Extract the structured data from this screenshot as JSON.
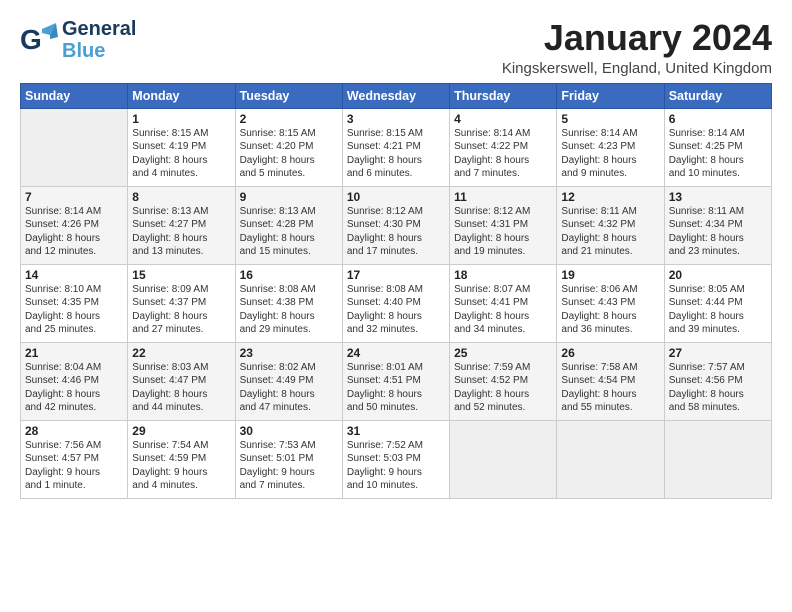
{
  "logo": {
    "line1": "General",
    "line2": "Blue"
  },
  "title": "January 2024",
  "subtitle": "Kingskerswell, England, United Kingdom",
  "weekdays": [
    "Sunday",
    "Monday",
    "Tuesday",
    "Wednesday",
    "Thursday",
    "Friday",
    "Saturday"
  ],
  "weeks": [
    [
      {
        "day": "",
        "info": ""
      },
      {
        "day": "1",
        "info": "Sunrise: 8:15 AM\nSunset: 4:19 PM\nDaylight: 8 hours\nand 4 minutes."
      },
      {
        "day": "2",
        "info": "Sunrise: 8:15 AM\nSunset: 4:20 PM\nDaylight: 8 hours\nand 5 minutes."
      },
      {
        "day": "3",
        "info": "Sunrise: 8:15 AM\nSunset: 4:21 PM\nDaylight: 8 hours\nand 6 minutes."
      },
      {
        "day": "4",
        "info": "Sunrise: 8:14 AM\nSunset: 4:22 PM\nDaylight: 8 hours\nand 7 minutes."
      },
      {
        "day": "5",
        "info": "Sunrise: 8:14 AM\nSunset: 4:23 PM\nDaylight: 8 hours\nand 9 minutes."
      },
      {
        "day": "6",
        "info": "Sunrise: 8:14 AM\nSunset: 4:25 PM\nDaylight: 8 hours\nand 10 minutes."
      }
    ],
    [
      {
        "day": "7",
        "info": "Sunrise: 8:14 AM\nSunset: 4:26 PM\nDaylight: 8 hours\nand 12 minutes."
      },
      {
        "day": "8",
        "info": "Sunrise: 8:13 AM\nSunset: 4:27 PM\nDaylight: 8 hours\nand 13 minutes."
      },
      {
        "day": "9",
        "info": "Sunrise: 8:13 AM\nSunset: 4:28 PM\nDaylight: 8 hours\nand 15 minutes."
      },
      {
        "day": "10",
        "info": "Sunrise: 8:12 AM\nSunset: 4:30 PM\nDaylight: 8 hours\nand 17 minutes."
      },
      {
        "day": "11",
        "info": "Sunrise: 8:12 AM\nSunset: 4:31 PM\nDaylight: 8 hours\nand 19 minutes."
      },
      {
        "day": "12",
        "info": "Sunrise: 8:11 AM\nSunset: 4:32 PM\nDaylight: 8 hours\nand 21 minutes."
      },
      {
        "day": "13",
        "info": "Sunrise: 8:11 AM\nSunset: 4:34 PM\nDaylight: 8 hours\nand 23 minutes."
      }
    ],
    [
      {
        "day": "14",
        "info": "Sunrise: 8:10 AM\nSunset: 4:35 PM\nDaylight: 8 hours\nand 25 minutes."
      },
      {
        "day": "15",
        "info": "Sunrise: 8:09 AM\nSunset: 4:37 PM\nDaylight: 8 hours\nand 27 minutes."
      },
      {
        "day": "16",
        "info": "Sunrise: 8:08 AM\nSunset: 4:38 PM\nDaylight: 8 hours\nand 29 minutes."
      },
      {
        "day": "17",
        "info": "Sunrise: 8:08 AM\nSunset: 4:40 PM\nDaylight: 8 hours\nand 32 minutes."
      },
      {
        "day": "18",
        "info": "Sunrise: 8:07 AM\nSunset: 4:41 PM\nDaylight: 8 hours\nand 34 minutes."
      },
      {
        "day": "19",
        "info": "Sunrise: 8:06 AM\nSunset: 4:43 PM\nDaylight: 8 hours\nand 36 minutes."
      },
      {
        "day": "20",
        "info": "Sunrise: 8:05 AM\nSunset: 4:44 PM\nDaylight: 8 hours\nand 39 minutes."
      }
    ],
    [
      {
        "day": "21",
        "info": "Sunrise: 8:04 AM\nSunset: 4:46 PM\nDaylight: 8 hours\nand 42 minutes."
      },
      {
        "day": "22",
        "info": "Sunrise: 8:03 AM\nSunset: 4:47 PM\nDaylight: 8 hours\nand 44 minutes."
      },
      {
        "day": "23",
        "info": "Sunrise: 8:02 AM\nSunset: 4:49 PM\nDaylight: 8 hours\nand 47 minutes."
      },
      {
        "day": "24",
        "info": "Sunrise: 8:01 AM\nSunset: 4:51 PM\nDaylight: 8 hours\nand 50 minutes."
      },
      {
        "day": "25",
        "info": "Sunrise: 7:59 AM\nSunset: 4:52 PM\nDaylight: 8 hours\nand 52 minutes."
      },
      {
        "day": "26",
        "info": "Sunrise: 7:58 AM\nSunset: 4:54 PM\nDaylight: 8 hours\nand 55 minutes."
      },
      {
        "day": "27",
        "info": "Sunrise: 7:57 AM\nSunset: 4:56 PM\nDaylight: 8 hours\nand 58 minutes."
      }
    ],
    [
      {
        "day": "28",
        "info": "Sunrise: 7:56 AM\nSunset: 4:57 PM\nDaylight: 9 hours\nand 1 minute."
      },
      {
        "day": "29",
        "info": "Sunrise: 7:54 AM\nSunset: 4:59 PM\nDaylight: 9 hours\nand 4 minutes."
      },
      {
        "day": "30",
        "info": "Sunrise: 7:53 AM\nSunset: 5:01 PM\nDaylight: 9 hours\nand 7 minutes."
      },
      {
        "day": "31",
        "info": "Sunrise: 7:52 AM\nSunset: 5:03 PM\nDaylight: 9 hours\nand 10 minutes."
      },
      {
        "day": "",
        "info": ""
      },
      {
        "day": "",
        "info": ""
      },
      {
        "day": "",
        "info": ""
      }
    ]
  ]
}
